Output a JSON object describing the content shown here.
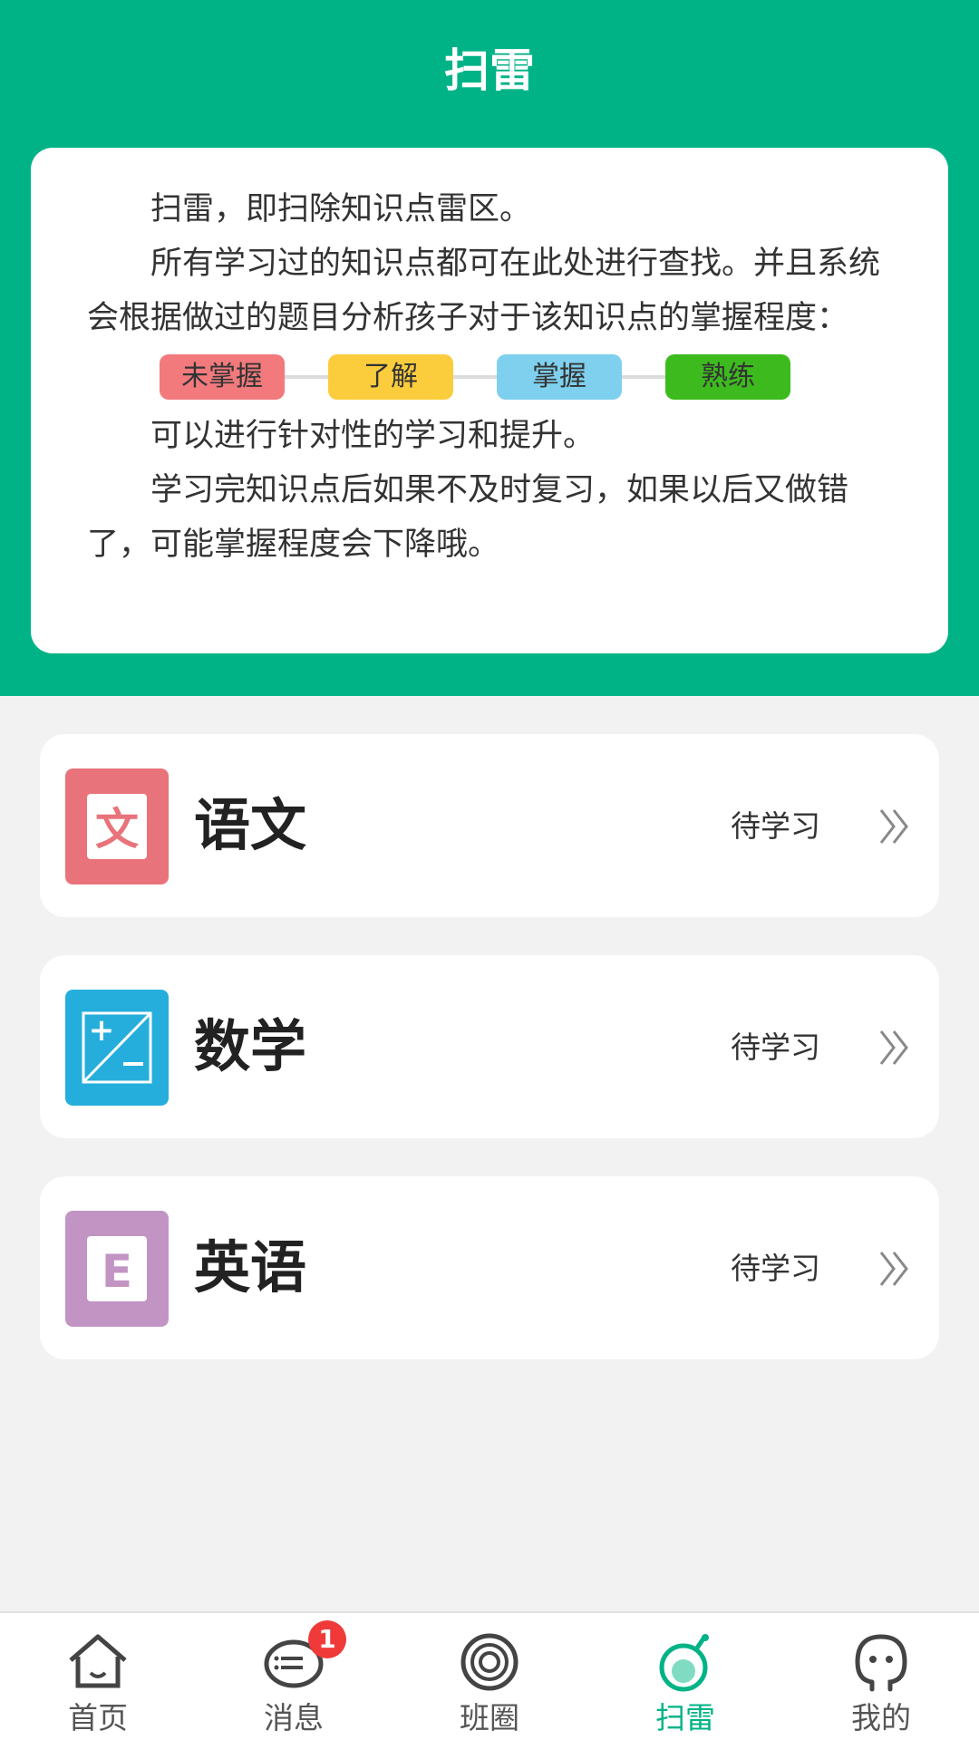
{
  "header": {
    "title": "扫雷"
  },
  "intro": {
    "line1": "扫雷，即扫除知识点雷区。",
    "line2": "所有学习过的知识点都可在此处进行查找。并且系统会根据做过的题目分析孩子对于该知识点的掌握程度：",
    "levels": [
      {
        "label": "未掌握",
        "color": "#f27a7d"
      },
      {
        "label": "了解",
        "color": "#fbcd3d"
      },
      {
        "label": "掌握",
        "color": "#7fd0ee"
      },
      {
        "label": "熟练",
        "color": "#3dbb1e"
      }
    ],
    "line3": "可以进行针对性的学习和提升。",
    "line4": "学习完知识点后如果不及时复习，如果以后又做错了，可能掌握程度会下降哦。"
  },
  "subjects": [
    {
      "name": "语文",
      "status": "待学习",
      "icon": "chinese-icon",
      "color": "#e8737a"
    },
    {
      "name": "数学",
      "status": "待学习",
      "icon": "math-icon",
      "color": "#25aedb"
    },
    {
      "name": "英语",
      "status": "待学习",
      "icon": "english-icon",
      "color": "#c294c4"
    }
  ],
  "tabbar": {
    "items": [
      {
        "label": "首页",
        "icon": "home-icon"
      },
      {
        "label": "消息",
        "icon": "message-icon",
        "badge": "1"
      },
      {
        "label": "班圈",
        "icon": "class-circle-icon"
      },
      {
        "label": "扫雷",
        "icon": "minesweeper-icon",
        "active": true
      },
      {
        "label": "我的",
        "icon": "profile-icon"
      }
    ]
  },
  "colors": {
    "primary": "#00b386",
    "background": "#f2f2f2"
  }
}
